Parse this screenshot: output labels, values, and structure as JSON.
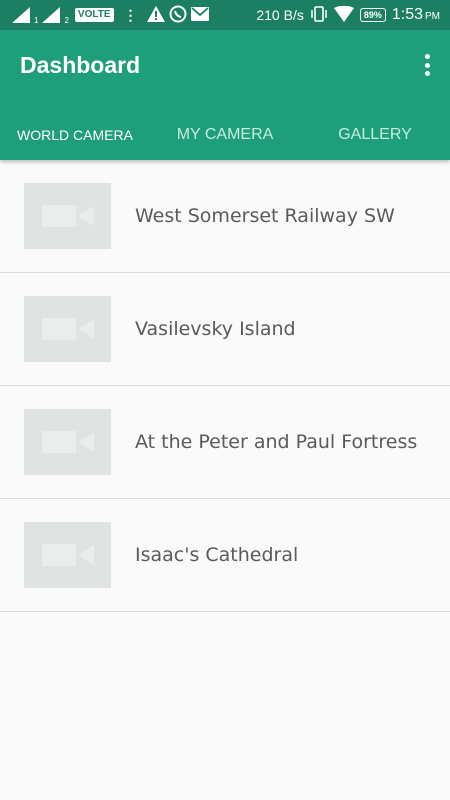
{
  "status_bar": {
    "sim1_label": "1",
    "sim2_label": "2",
    "volte": "VOLTE",
    "net_speed": "210 B/s",
    "battery": "89%",
    "time": "1:53",
    "ampm": "PM",
    "icons": [
      "signal-icon",
      "signal-icon",
      "more-notifications-icon",
      "warning-icon",
      "whatsapp-icon",
      "mail-icon",
      "vibrate-icon",
      "wifi-icon",
      "battery-icon"
    ]
  },
  "app_bar": {
    "title": "Dashboard",
    "menu_icon": "overflow-menu-icon",
    "color": "#1e9e7b",
    "status_color": "#1c7f64"
  },
  "tabs": [
    {
      "label": "WORLD CAMERA",
      "active": true
    },
    {
      "label": "MY CAMERA",
      "active": false
    },
    {
      "label": "GALLERY",
      "active": false
    }
  ],
  "cameras": [
    {
      "name": "West Somerset Railway SW",
      "icon": "video-camera-icon"
    },
    {
      "name": "Vasilevsky Island",
      "icon": "video-camera-icon"
    },
    {
      "name": "At the Peter and Paul Fortress",
      "icon": "video-camera-icon"
    },
    {
      "name": "Isaac's Cathedral",
      "icon": "video-camera-icon"
    }
  ]
}
